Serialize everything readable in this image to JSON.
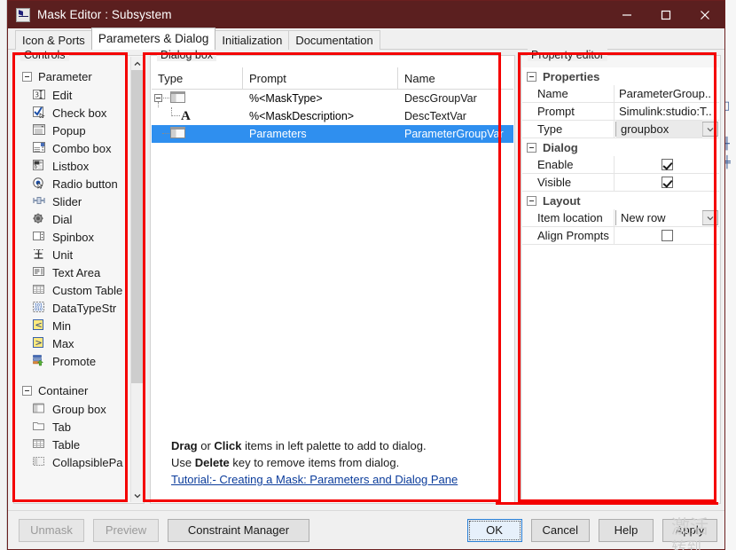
{
  "window": {
    "title": "Mask Editor : Subsystem",
    "icon": "matlab-mask-icon",
    "controls": {
      "minimize": "minimize-icon",
      "maximize": "maximize-icon",
      "close": "close-icon"
    },
    "titlebar_color": "#5b1f1f"
  },
  "tabs": [
    {
      "label": "Icon & Ports",
      "active": false
    },
    {
      "label": "Parameters & Dialog",
      "active": true
    },
    {
      "label": "Initialization",
      "active": false
    },
    {
      "label": "Documentation",
      "active": false
    }
  ],
  "palette": {
    "title": "Controls",
    "groups": [
      {
        "name": "Parameter",
        "expanded": true,
        "items": [
          {
            "label": "Edit",
            "icon": "edit-field-icon"
          },
          {
            "label": "Check box",
            "icon": "check-box-icon"
          },
          {
            "label": "Popup",
            "icon": "popup-icon"
          },
          {
            "label": "Combo box",
            "icon": "combo-box-icon"
          },
          {
            "label": "Listbox",
            "icon": "listbox-icon"
          },
          {
            "label": "Radio button",
            "icon": "radio-button-icon"
          },
          {
            "label": "Slider",
            "icon": "slider-icon"
          },
          {
            "label": "Dial",
            "icon": "dial-icon"
          },
          {
            "label": "Spinbox",
            "icon": "spinbox-icon"
          },
          {
            "label": "Unit",
            "icon": "unit-icon"
          },
          {
            "label": "Text Area",
            "icon": "text-area-icon"
          },
          {
            "label": "Custom Table",
            "icon": "custom-table-icon"
          },
          {
            "label": "DataTypeStr",
            "icon": "datatypestr-icon"
          },
          {
            "label": "Min",
            "icon": "min-icon"
          },
          {
            "label": "Max",
            "icon": "max-icon"
          },
          {
            "label": "Promote",
            "icon": "promote-icon"
          }
        ]
      },
      {
        "name": "Container",
        "expanded": true,
        "items": [
          {
            "label": "Group box",
            "icon": "group-box-icon"
          },
          {
            "label": "Tab",
            "icon": "tab-icon"
          },
          {
            "label": "Table",
            "icon": "table-icon"
          },
          {
            "label": "CollapsiblePa",
            "icon": "collapsible-panel-icon"
          }
        ]
      }
    ],
    "scrollbar": {
      "up": "scroll-up-arrow",
      "down": "scroll-down-arrow"
    }
  },
  "dialog_box": {
    "title": "Dialog box",
    "columns": [
      "Type",
      "Prompt",
      "Name"
    ],
    "rows": [
      {
        "icon": "group-box-icon",
        "prompt": "%<MaskType>",
        "name": "DescGroupVar",
        "depth": 0,
        "selected": false,
        "expander": true
      },
      {
        "icon": "text-glyph-A",
        "prompt": "%<MaskDescription>",
        "name": "DescTextVar",
        "depth": 1,
        "selected": false,
        "expander": false
      },
      {
        "icon": "group-box-icon",
        "prompt": "Parameters",
        "name": "ParameterGroupVar",
        "depth": 1,
        "selected": true,
        "expander": false
      }
    ],
    "help": {
      "line1_parts": [
        "Drag",
        " or ",
        "Click",
        " items in left palette to add to dialog."
      ],
      "line2_parts": [
        "Use ",
        "Delete",
        " key to remove items from dialog."
      ],
      "link": "Tutorial:- Creating a Mask: Parameters and Dialog Pane"
    }
  },
  "property_editor": {
    "title": "Property editor",
    "sections": [
      {
        "name": "Properties",
        "rows": [
          {
            "label": "Name",
            "value": "ParameterGroup..",
            "kind": "text"
          },
          {
            "label": "Prompt",
            "value": "Simulink:studio:T..",
            "kind": "text"
          },
          {
            "label": "Type",
            "value": "groupbox",
            "kind": "combo"
          }
        ]
      },
      {
        "name": "Dialog",
        "rows": [
          {
            "label": "Enable",
            "value": "",
            "kind": "checkbox",
            "checked": true
          },
          {
            "label": "Visible",
            "value": "",
            "kind": "checkbox",
            "checked": true
          }
        ]
      },
      {
        "name": "Layout",
        "rows": [
          {
            "label": "Item location",
            "value": "New row",
            "kind": "combo-white"
          },
          {
            "label": "Align Prompts",
            "value": "",
            "kind": "checkbox",
            "checked": false
          }
        ]
      }
    ]
  },
  "bottom_bar": {
    "left_buttons": [
      {
        "label": "Unmask",
        "disabled": true
      },
      {
        "label": "Preview",
        "disabled": true
      },
      {
        "label": "Constraint Manager",
        "disabled": false
      }
    ],
    "right_buttons": [
      {
        "label": "OK",
        "default": true
      },
      {
        "label": "Cancel",
        "default": false
      },
      {
        "label": "Help",
        "default": false
      },
      {
        "label": "Apply",
        "default": false
      }
    ]
  },
  "annotations": {
    "color": "#f40000",
    "boxes": [
      "controls-palette",
      "dialog-box-panel",
      "property-editor-panel",
      "ok-button-row"
    ]
  },
  "watermark": {
    "line1": "激活",
    "line2": "转到"
  }
}
